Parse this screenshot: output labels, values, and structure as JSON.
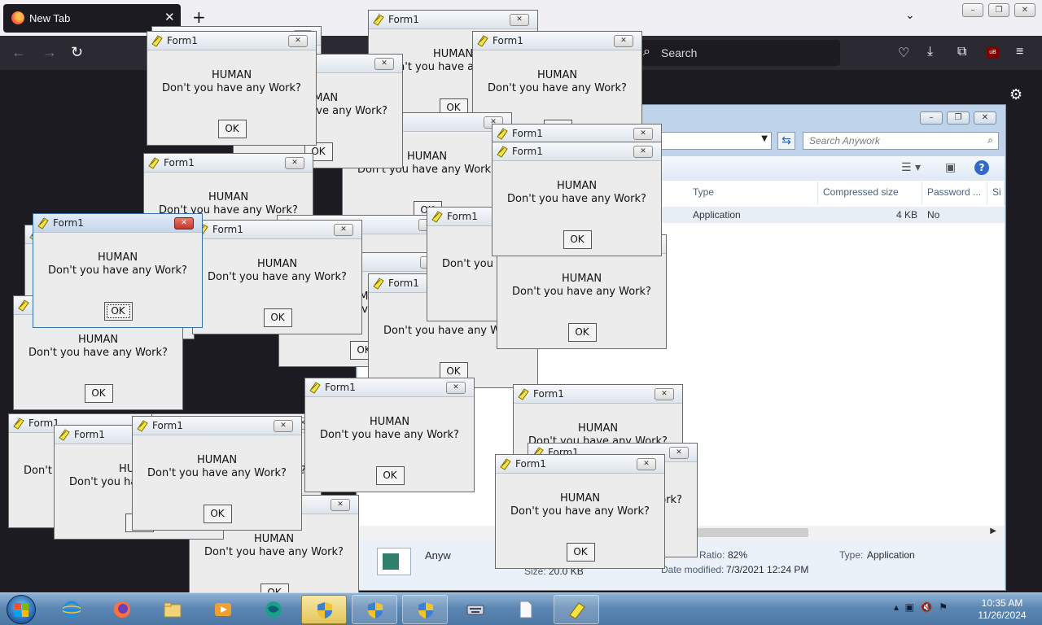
{
  "browser": {
    "tab_title": "New Tab",
    "tab_close": "✕",
    "new_tab": "+",
    "tab_list": "⌄",
    "search_placeholder": "Search",
    "ublock_label": "uB",
    "win_min": "–",
    "win_max": "❐",
    "win_close": "✕"
  },
  "archive": {
    "search_placeholder": "Search Anywork",
    "columns": [
      "Type",
      "Compressed size",
      "Password ...",
      "Si"
    ],
    "row": {
      "type": "Application",
      "compressed_size": "4 KB",
      "password": "No"
    },
    "details": {
      "name": "Anyw",
      "ratio_label": "Ratio:",
      "ratio": "82%",
      "type_label": "Type:",
      "type": "Application",
      "size_label": "Size:",
      "size": "20.0 KB",
      "date_label": "Date modified:",
      "date": "7/3/2021 12:24 PM"
    }
  },
  "dialog": {
    "title": "Form1",
    "line1": "HUMAN",
    "line2": "Don't you have any Work?",
    "ok": "OK",
    "close": "✕"
  },
  "taskbar": {
    "time": "10:35 AM",
    "date": "11/26/2024",
    "icons": [
      "internet-explorer-icon",
      "firefox-icon",
      "folder-icon",
      "media-player-icon",
      "globe-icon",
      "uac-shield-icon",
      "uac-shield-icon",
      "uac-shield-icon",
      "keyboard-icon",
      "blank-document-icon",
      "form1-icon"
    ]
  }
}
